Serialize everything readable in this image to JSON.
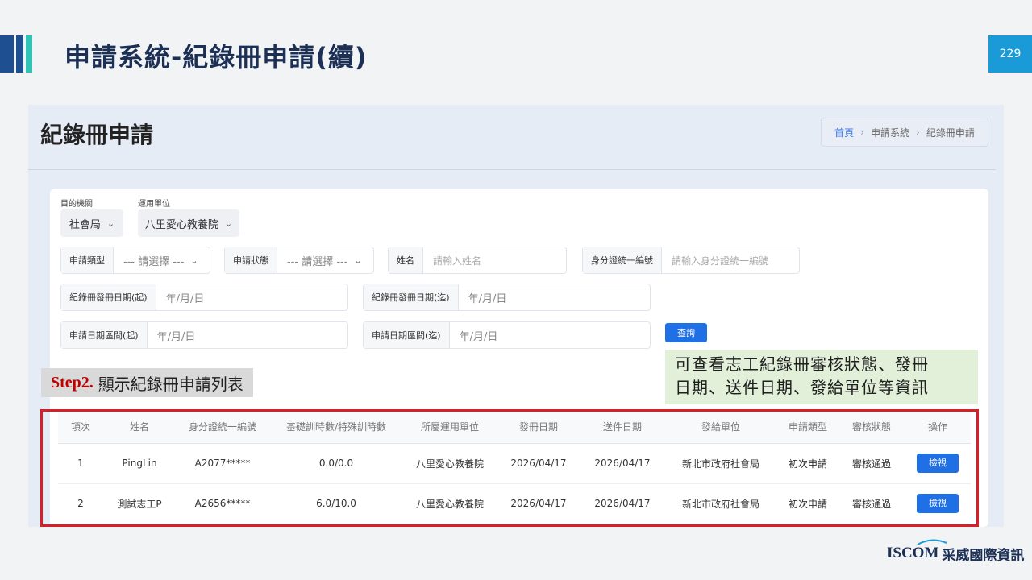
{
  "slide": {
    "title": "申請系統-紀錄冊申請(續)",
    "page_number": "229"
  },
  "page": {
    "heading": "紀錄冊申請",
    "breadcrumb": [
      "首頁",
      "申請系統",
      "紀錄冊申請"
    ]
  },
  "filters": {
    "dept_label": "目的機關",
    "dept_value": "社會局",
    "unit_label": "運用單位",
    "unit_value": "八里愛心教養院",
    "apply_type_label": "申請類型",
    "apply_type_value": "--- 請選擇 ---",
    "apply_status_label": "申請狀態",
    "apply_status_value": "--- 請選擇 ---",
    "name_label": "姓名",
    "name_placeholder": "請輸入姓名",
    "id_label": "身分證統一編號",
    "id_placeholder": "請輸入身分證統一編號",
    "issue_start_label": "紀錄冊發冊日期(起)",
    "issue_start_value": "年/月/日",
    "issue_end_label": "紀錄冊發冊日期(迄)",
    "issue_end_value": "年/月/日",
    "apply_start_label": "申請日期區間(起)",
    "apply_start_value": "年/月/日",
    "apply_end_label": "申請日期區間(迄)",
    "apply_end_value": "年/月/日",
    "query_button": "查詢"
  },
  "table": {
    "headers": [
      "項次",
      "姓名",
      "身分證統一編號",
      "基礎訓時數/特殊訓時數",
      "所屬運用單位",
      "發冊日期",
      "送件日期",
      "發給單位",
      "申請類型",
      "審核狀態",
      "操作"
    ],
    "rows": [
      [
        "1",
        "PingLin",
        "A2077*****",
        "0.0/0.0",
        "八里愛心教養院",
        "2026/04/17",
        "2026/04/17",
        "新北市政府社會局",
        "初次申請",
        "審核通過",
        "檢視"
      ],
      [
        "2",
        "測試志工P",
        "A2656*****",
        "6.0/10.0",
        "八里愛心教養院",
        "2026/04/17",
        "2026/04/17",
        "新北市政府社會局",
        "初次申請",
        "審核通過",
        "檢視"
      ]
    ]
  },
  "annotations": {
    "step_number": "Step2.",
    "step_text": "顯示紀錄冊申請列表",
    "callout_line1": "可查看志工紀錄冊審核狀態、發冊",
    "callout_line2": "日期、送件日期、發給單位等資訊"
  },
  "logo": {
    "brand": "ISCOM",
    "company": "采威國際資訊"
  },
  "colors": {
    "primary_blue": "#1f6fe5",
    "title_navy": "#1c2f55",
    "highlight_red": "#d61f26",
    "callout_green": "#e2efd9",
    "page_num_blue": "#1a9ad6"
  }
}
